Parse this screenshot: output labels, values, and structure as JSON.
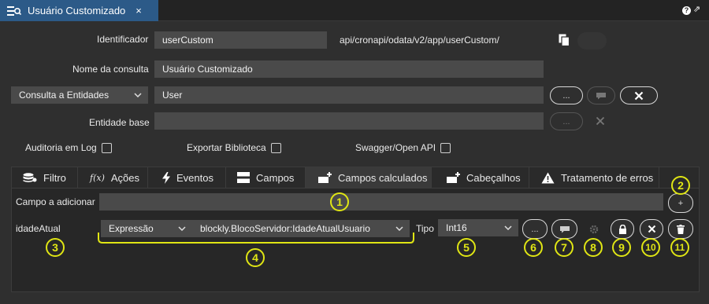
{
  "tab": {
    "title": "Usuário Customizado",
    "close": "×"
  },
  "window": {
    "help": "?",
    "popout": "⇗"
  },
  "form": {
    "identificador_label": "Identificador",
    "identificador_value": "userCustom",
    "url": "api/cronapi/odata/v2/app/userCustom/",
    "nome_label": "Nome da consulta",
    "nome_value": "Usuário Customizado",
    "consulta_select": "Consulta a Entidades",
    "entidade_value": "User",
    "ellipsis": "...",
    "entidade_base_label": "Entidade base",
    "entidade_base_value": ""
  },
  "checks": {
    "auditoria": "Auditoria em Log",
    "exportar": "Exportar Biblioteca",
    "swagger": "Swagger/Open API"
  },
  "tabs": [
    {
      "label": "Filtro",
      "icon": "database-icon"
    },
    {
      "label": "Ações",
      "icon": "function-icon"
    },
    {
      "label": "Eventos",
      "icon": "lightning-icon"
    },
    {
      "label": "Campos",
      "icon": "fields-icon"
    },
    {
      "label": "Campos calculados",
      "icon": "add-field-icon"
    },
    {
      "label": "Cabeçalhos",
      "icon": "add-header-icon"
    },
    {
      "label": "Tratamento de erros",
      "icon": "warning-icon"
    }
  ],
  "calc": {
    "campo_label": "Campo a adicionar",
    "campo_value": "",
    "add": "+",
    "field_name": "idadeAtual",
    "type_select": "Expressão",
    "expression": "blockly.BlocoServidor:IdadeAtualUsuario",
    "tipo_label": "Tipo",
    "tipo_value": "Int16",
    "ellipsis": "..."
  },
  "callouts": [
    "1",
    "2",
    "3",
    "4",
    "5",
    "6",
    "7",
    "8",
    "9",
    "10",
    "11"
  ],
  "colors": {
    "accent": "#2c5a88",
    "callout": "#e0e614"
  }
}
